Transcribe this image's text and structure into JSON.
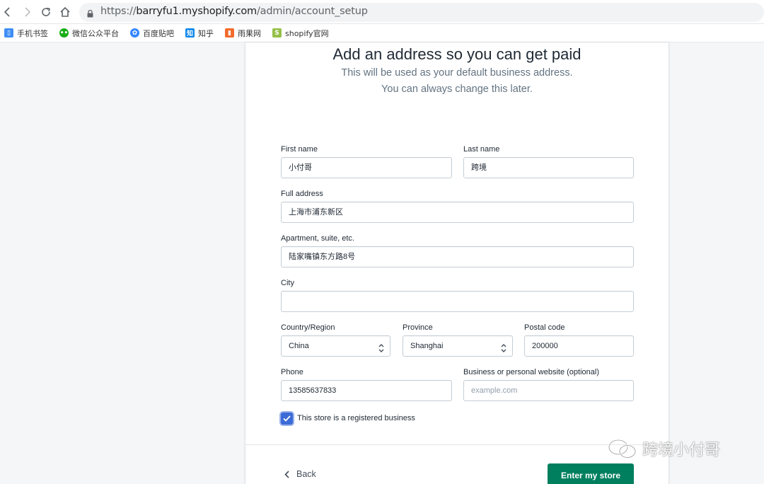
{
  "browser": {
    "url_scheme": "https://",
    "url_host": "barryfu1.myshopify.com",
    "url_path": "/admin/account_setup",
    "bookmarks": [
      {
        "label": "手机书签",
        "icon": "phone-bookmark-icon",
        "color": "#3f8ef5"
      },
      {
        "label": "微信公众平台",
        "icon": "wechat-icon",
        "color": "#1aad19"
      },
      {
        "label": "百度贴吧",
        "icon": "baidu-paw-icon",
        "color": "#3385ff"
      },
      {
        "label": "知乎",
        "icon": "zhihu-icon",
        "color": "#0f88eb"
      },
      {
        "label": "雨果网",
        "icon": "cifnews-icon",
        "color": "#f26b2a"
      },
      {
        "label": "shopify官网",
        "icon": "shopify-bag-icon",
        "color": "#95bf47"
      }
    ]
  },
  "page": {
    "title": "Add an address so you can get paid",
    "subtitle_line1": "This will be used as your default business address.",
    "subtitle_line2": "You can always change this later."
  },
  "form": {
    "first_name": {
      "label": "First name",
      "value": "小付哥"
    },
    "last_name": {
      "label": "Last name",
      "value": "跨境"
    },
    "full_address": {
      "label": "Full address",
      "value": "上海市浦东新区"
    },
    "apartment": {
      "label": "Apartment, suite, etc.",
      "value": "陆家嘴镇东方路8号"
    },
    "city": {
      "label": "City",
      "value": ""
    },
    "country": {
      "label": "Country/Region",
      "value": "China"
    },
    "province": {
      "label": "Province",
      "value": "Shanghai"
    },
    "postal_code": {
      "label": "Postal code",
      "value": "200000"
    },
    "phone": {
      "label": "Phone",
      "value": "13585637833"
    },
    "website": {
      "label": "Business or personal website (optional)",
      "value": "",
      "placeholder": "example.com"
    },
    "registered_business": {
      "label": "This store is a registered business",
      "checked": true
    }
  },
  "footer": {
    "back_label": "Back",
    "submit_label": "Enter my store"
  },
  "watermark": {
    "text": "跨境小付哥",
    "icon": "wechat-official-account-icon"
  },
  "colors": {
    "primary": "#007f5f",
    "checkbox": "#3b6bd6"
  }
}
